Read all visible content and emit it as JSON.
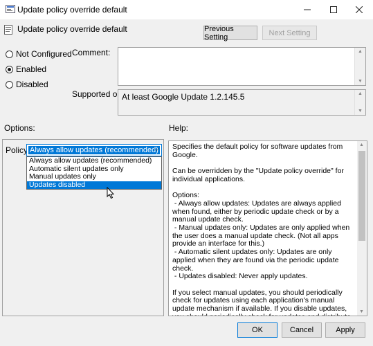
{
  "window": {
    "title": "Update policy override default"
  },
  "header": {
    "setting_name": "Update policy override default",
    "prev_label": "Previous Setting",
    "next_label": "Next Setting"
  },
  "state": {
    "options": [
      "Not Configured",
      "Enabled",
      "Disabled"
    ],
    "selected": "Enabled"
  },
  "comment": {
    "label": "Comment:",
    "value": ""
  },
  "supported": {
    "label": "Supported on:",
    "value": "At least Google Update 1.2.145.5"
  },
  "options_section": {
    "label": "Options:",
    "policy_label": "Policy",
    "dropdown_value": "Always allow updates (recommended)",
    "dropdown_items": [
      "Always allow updates (recommended)",
      "Automatic silent updates only",
      "Manual updates only",
      "Updates disabled"
    ],
    "highlighted_item": "Updates disabled"
  },
  "help_section": {
    "label": "Help:",
    "text": "Specifies the default policy for software updates from Google.\n\nCan be overridden by the \"Update policy override\" for individual applications.\n\nOptions:\n - Always allow updates: Updates are always applied when found, either by periodic update check or by a manual update check.\n - Manual updates only: Updates are only applied when the user does a manual update check. (Not all apps provide an interface for this.)\n - Automatic silent updates only: Updates are only applied when they are found via the periodic update check.\n - Updates disabled: Never apply updates.\n\nIf you select manual updates, you should periodically check for updates using each application's manual update mechanism if available. If you disable updates, you should periodically check for updates and distribute them to users.\n\nOnly affects updates for Google software that uses Google"
  },
  "footer": {
    "ok_label": "OK",
    "cancel_label": "Cancel",
    "apply_label": "Apply"
  },
  "colors": {
    "accent": "#0078d7",
    "dialog_bg": "#f0f0f0"
  }
}
